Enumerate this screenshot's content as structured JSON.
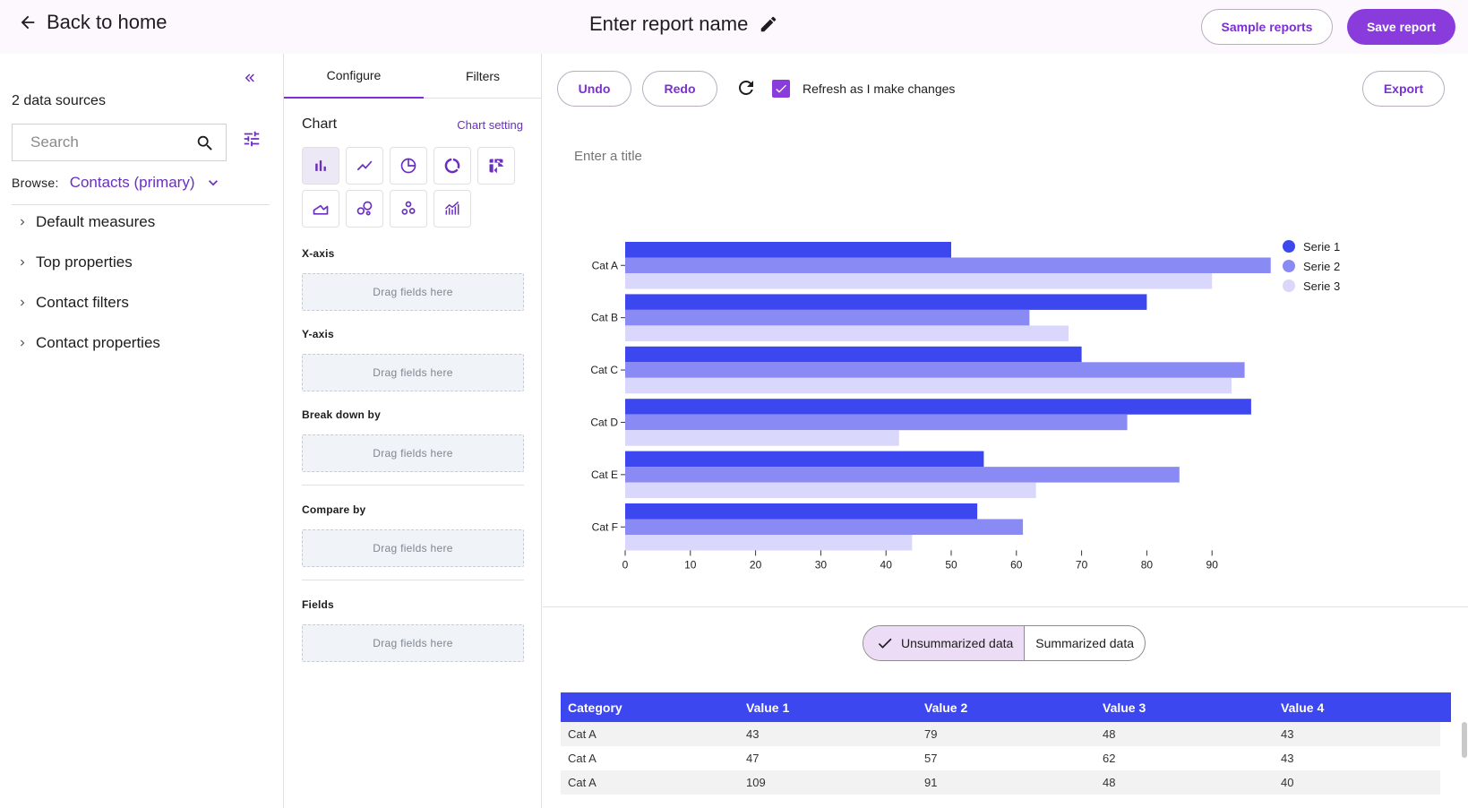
{
  "header": {
    "back_label": "Back to home",
    "report_name": "Enter report name",
    "sample_reports": "Sample reports",
    "save_report": "Save report"
  },
  "left_panel": {
    "data_sources": "2 data sources",
    "search_placeholder": "Search",
    "browse_label": "Browse:",
    "browse_value": "Contacts (primary)",
    "tree": [
      {
        "label": "Default measures"
      },
      {
        "label": "Top properties"
      },
      {
        "label": "Contact filters"
      },
      {
        "label": "Contact properties"
      }
    ]
  },
  "config_panel": {
    "tabs": [
      "Configure",
      "Filters"
    ],
    "chart_label": "Chart",
    "chart_setting": "Chart setting",
    "chart_types": [
      "bar-chart-icon",
      "line-chart-icon",
      "pie-chart-icon",
      "donut-chart-icon",
      "pivot-table-icon",
      "area-chart-icon",
      "bubble-chart-icon",
      "scatter-chart-icon",
      "combo-chart-icon"
    ],
    "sections": [
      {
        "label": "X-axis",
        "drop": "Drag fields here"
      },
      {
        "label": "Y-axis",
        "drop": "Drag fields here"
      },
      {
        "label": "Break down by",
        "drop": "Drag fields here"
      },
      {
        "label": "Compare by",
        "drop": "Drag fields here"
      },
      {
        "label": "Fields",
        "drop": "Drag fields here"
      }
    ]
  },
  "toolbar": {
    "undo": "Undo",
    "redo": "Redo",
    "refresh_label": "Refresh as I make changes",
    "refresh_checked": true,
    "export": "Export"
  },
  "chart_title_placeholder": "Enter a title",
  "chart_data": {
    "type": "bar",
    "orientation": "horizontal",
    "categories": [
      "Cat A",
      "Cat B",
      "Cat C",
      "Cat D",
      "Cat E",
      "Cat F"
    ],
    "series": [
      {
        "name": "Serie 1",
        "values": [
          50,
          80,
          70,
          96,
          55,
          54
        ],
        "color": "#3d47f0"
      },
      {
        "name": "Serie 2",
        "values": [
          99,
          62,
          95,
          77,
          85,
          61
        ],
        "color": "#8a8af4"
      },
      {
        "name": "Serie 3",
        "values": [
          90,
          68,
          93,
          42,
          63,
          44
        ],
        "color": "#d9d7fb"
      }
    ],
    "x_ticks": [
      0,
      10,
      20,
      30,
      40,
      50,
      60,
      70,
      80,
      90
    ],
    "xlim": [
      0,
      100
    ],
    "legend": "top-right",
    "grid": false
  },
  "data_toggle": {
    "unsummarized": "Unsummarized data",
    "summarized": "Summarized data",
    "selected": "unsummarized"
  },
  "table": {
    "headers": [
      "Category",
      "Value 1",
      "Value 2",
      "Value 3",
      "Value 4"
    ],
    "rows": [
      [
        "Cat A",
        "43",
        "79",
        "48",
        "43"
      ],
      [
        "Cat A",
        "47",
        "57",
        "62",
        "43"
      ],
      [
        "Cat A",
        "109",
        "91",
        "48",
        "40"
      ]
    ]
  },
  "colors": {
    "accent": "#8a3bdb",
    "accent_text": "#7b2fd4",
    "header_bg": "#fdf8fe",
    "table_header": "#3d47f0"
  }
}
